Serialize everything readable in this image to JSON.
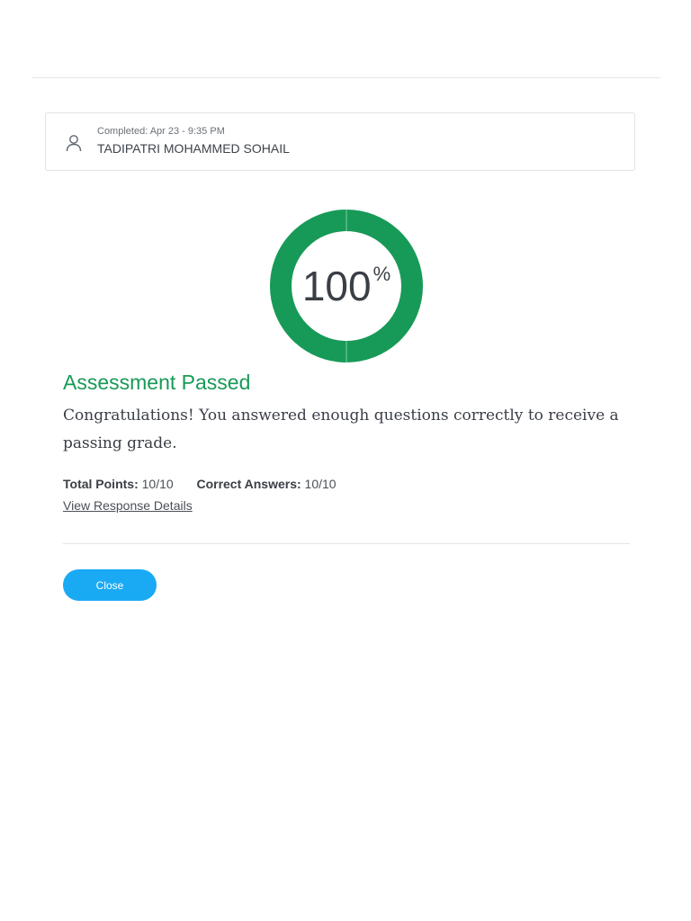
{
  "submission": {
    "completed_label": "Completed: Apr 23 - 9:35 PM",
    "user_name": "TADIPATRI MOHAMMED SOHAIL"
  },
  "score": {
    "value": "100",
    "unit": "%",
    "fraction": 1.0,
    "ring_color": "#179a57"
  },
  "result": {
    "title": "Assessment Passed",
    "message": "Congratulations! You answered enough questions correctly to receive a passing grade.",
    "title_color": "#179a57"
  },
  "stats": {
    "total_points_label": "Total Points:",
    "total_points_value": "10/10",
    "correct_answers_label": "Correct Answers:",
    "correct_answers_value": "10/10"
  },
  "links": {
    "view_details": "View Response Details"
  },
  "actions": {
    "close_label": "Close",
    "close_color": "#1aaaf4"
  },
  "icons": {
    "user": "user-icon"
  }
}
